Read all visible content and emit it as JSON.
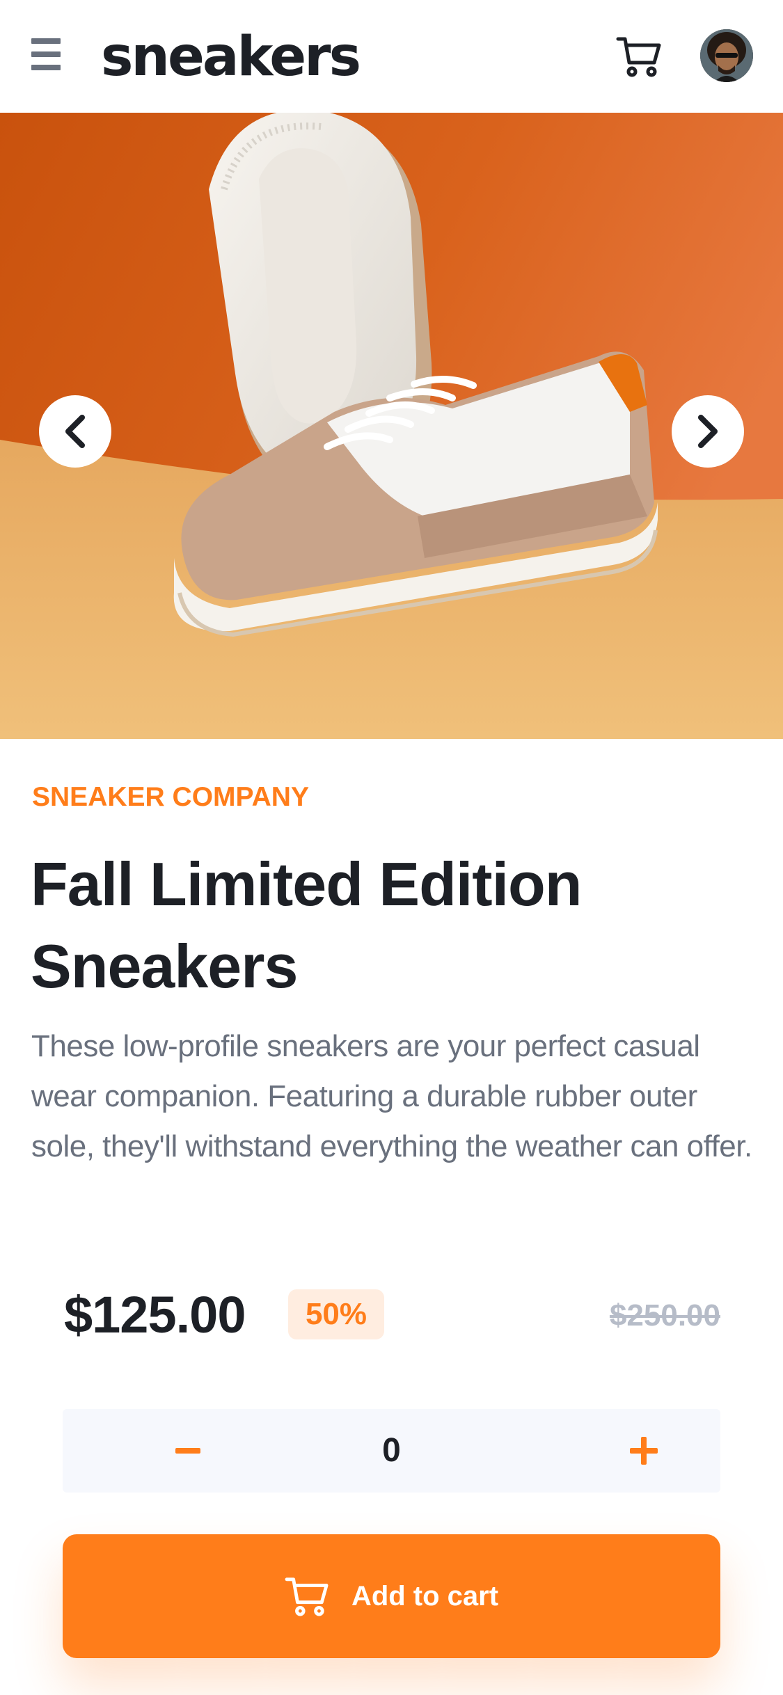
{
  "header": {
    "logo": "sneakers",
    "menu_icon": "hamburger-menu-icon",
    "cart_icon": "cart-icon",
    "avatar_icon": "user-avatar"
  },
  "gallery": {
    "prev_icon": "chevron-left-icon",
    "next_icon": "chevron-right-icon"
  },
  "product": {
    "company": "SNEAKER COMPANY",
    "title": "Fall Limited Edition Sneakers",
    "description": "These low-profile sneakers are your perfect casual wear companion. Featuring a durable rubber outer sole, they'll withstand everything the weather can offer.",
    "price": "$125.00",
    "discount": "50%",
    "old_price": "$250.00"
  },
  "quantity": {
    "minus_label": "–",
    "value": "0",
    "plus_label": "+"
  },
  "cta": {
    "label": "Add to cart",
    "icon": "cart-icon"
  },
  "colors": {
    "accent": "#ff7d1a",
    "accent_pale": "#ffede0",
    "dark": "#1d2026",
    "grey": "#69707d",
    "light_grey": "#b6bcc8",
    "surface": "#f6f8fd"
  }
}
